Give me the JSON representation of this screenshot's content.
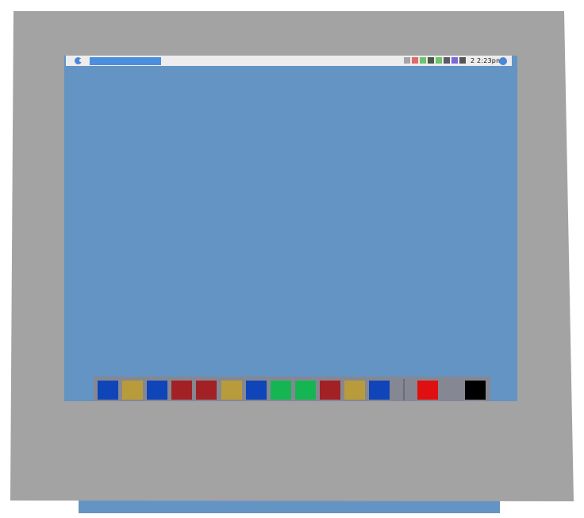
{
  "menubar": {
    "clock": "2 2:23pm",
    "apple_icon": "apple-logo-icon",
    "globe_icon": "globe-icon",
    "highlight_color": "#4c8ede",
    "tray_colors": [
      "#a4a4a4",
      "#e06a6a",
      "#6cc46c",
      "#4a5a4a",
      "#6cc46c",
      "#5a5a6a",
      "#7a6ad8",
      "#555555"
    ]
  },
  "dock": {
    "apps": [
      {
        "name": "app-1",
        "color": "#0f45b8"
      },
      {
        "name": "app-2",
        "color": "#b89b3b"
      },
      {
        "name": "app-3",
        "color": "#0f45b8"
      },
      {
        "name": "app-4",
        "color": "#a12125"
      },
      {
        "name": "app-5",
        "color": "#a12125"
      },
      {
        "name": "app-6",
        "color": "#b89b3b"
      },
      {
        "name": "app-7",
        "color": "#0f45b8"
      },
      {
        "name": "app-8",
        "color": "#15b553"
      },
      {
        "name": "app-9",
        "color": "#15b553"
      },
      {
        "name": "app-10",
        "color": "#a12125"
      },
      {
        "name": "app-11",
        "color": "#b89b3b"
      },
      {
        "name": "app-12",
        "color": "#0f45b8"
      }
    ],
    "extras": [
      {
        "name": "red-item",
        "color": "#e01010"
      },
      {
        "name": "trash-item",
        "color": "#000000"
      }
    ]
  },
  "colors": {
    "desktop": "#6394c4",
    "bezel": "#a2a3a2",
    "dock": "#858893",
    "menubar": "#ededed"
  }
}
